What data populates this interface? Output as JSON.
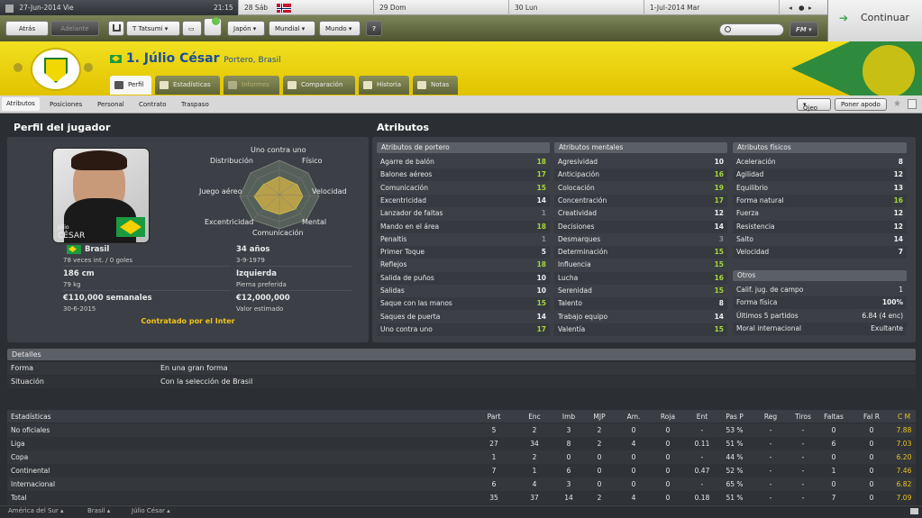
{
  "calendar": {
    "current_date": "27-Jun-2014 Vie",
    "time": "21:15",
    "days": [
      "28 Sáb",
      "29 Dom",
      "30 Lun",
      "1-Jul-2014 Mar"
    ]
  },
  "nav": {
    "back": "Atrás",
    "forward": "Adelante",
    "manager": "T Tatsumi",
    "menus": [
      "Japón",
      "Mundial",
      "Mundo"
    ],
    "help": "?",
    "search_placeholder": "",
    "fm": "FM",
    "continue": "Continuar"
  },
  "header": {
    "number_name": "1. Júlio César",
    "subtitle": "Portero, Brasil",
    "tabs": [
      "Perfil",
      "Estadísticas",
      "Informes",
      "Comparación",
      "Historia",
      "Notas"
    ],
    "accent": "#f1e020",
    "brand": "#2e8b3e"
  },
  "subnav": {
    "items": [
      "Atributos",
      "Posiciones",
      "Personal",
      "Contrato",
      "Traspaso"
    ],
    "right": [
      "Ojeo",
      "Poner apodo"
    ]
  },
  "profile": {
    "title": "Perfil del jugador",
    "card_first": "Júlio",
    "card_last": "CÉSAR",
    "radar_labels": [
      "Uno contra uno",
      "Físico",
      "Velocidad",
      "Mental",
      "Comunicación",
      "Excentricidad",
      "Juego aéreo",
      "Distribución"
    ],
    "info": [
      {
        "main": "Brasil",
        "sub": "78 veces int. / 0 goles"
      },
      {
        "main": "34 años",
        "sub": "3-9-1979"
      },
      {
        "main": "186 cm",
        "sub": "79 kg"
      },
      {
        "main": "Izquierda",
        "sub": "Pierna preferida"
      },
      {
        "main": "€110,000 semanales",
        "sub": "30-6-2015"
      },
      {
        "main": "€12,000,000",
        "sub": "Valor estimado"
      }
    ],
    "contracted": "Contratado por el Inter"
  },
  "attributes": {
    "title": "Atributos",
    "goalkeeper": {
      "header": "Atributos de portero",
      "items": [
        [
          "Agarre de balón",
          "18"
        ],
        [
          "Balones aéreos",
          "17"
        ],
        [
          "Comunicación",
          "15"
        ],
        [
          "Excentricidad",
          "14"
        ],
        [
          "Lanzador de faltas",
          "1"
        ],
        [
          "Mando en el área",
          "18"
        ],
        [
          "Penaltis",
          "1"
        ],
        [
          "Primer Toque",
          "5"
        ],
        [
          "Reflejos",
          "18"
        ],
        [
          "Salida de puños",
          "10"
        ],
        [
          "Salidas",
          "10"
        ],
        [
          "Saque con las manos",
          "15"
        ],
        [
          "Saques de puerta",
          "14"
        ],
        [
          "Uno contra uno",
          "17"
        ]
      ]
    },
    "mental": {
      "header": "Atributos mentales",
      "items": [
        [
          "Agresividad",
          "10"
        ],
        [
          "Anticipación",
          "16"
        ],
        [
          "Colocación",
          "19"
        ],
        [
          "Concentración",
          "17"
        ],
        [
          "Creatividad",
          "12"
        ],
        [
          "Decisiones",
          "14"
        ],
        [
          "Desmarques",
          "3"
        ],
        [
          "Determinación",
          "15"
        ],
        [
          "Influencia",
          "15"
        ],
        [
          "Lucha",
          "16"
        ],
        [
          "Serenidad",
          "15"
        ],
        [
          "Talento",
          "8"
        ],
        [
          "Trabajo equipo",
          "14"
        ],
        [
          "Valentía",
          "15"
        ]
      ]
    },
    "physical": {
      "header": "Atributos físicos",
      "items": [
        [
          "Aceleración",
          "8"
        ],
        [
          "Agilidad",
          "12"
        ],
        [
          "Equilibrio",
          "13"
        ],
        [
          "Forma natural",
          "16"
        ],
        [
          "Fuerza",
          "12"
        ],
        [
          "Resistencia",
          "12"
        ],
        [
          "Salto",
          "14"
        ],
        [
          "Velocidad",
          "7"
        ]
      ]
    },
    "other": {
      "header": "Otros",
      "items": [
        [
          "Calif. jug. de campo",
          "1"
        ],
        [
          "Forma física",
          "100%"
        ],
        [
          "Últimos 5 partidos",
          "6.84 (4 enc)"
        ],
        [
          "Moral internacional",
          "Exultante"
        ]
      ]
    }
  },
  "details": {
    "header": "Detalles",
    "rows": [
      [
        "Forma",
        "En una gran forma"
      ],
      [
        "Situación",
        "Con la selección de Brasil"
      ]
    ]
  },
  "stats": {
    "columns": [
      "Estadísticas",
      "Part",
      "Enc",
      "Imb",
      "MJP",
      "Am.",
      "Roja",
      "Ent",
      "Pas P",
      "Reg",
      "Tiros",
      "Faltas",
      "Fal R",
      "C M"
    ],
    "rows": [
      [
        "No oficiales",
        "5",
        "2",
        "3",
        "2",
        "0",
        "0",
        "-",
        "53 %",
        "-",
        "-",
        "0",
        "0",
        "7.88"
      ],
      [
        "Liga",
        "27",
        "34",
        "8",
        "2",
        "4",
        "0",
        "0.11",
        "51 %",
        "-",
        "-",
        "6",
        "0",
        "7.03"
      ],
      [
        "Copa",
        "1",
        "2",
        "0",
        "0",
        "0",
        "0",
        "-",
        "44 %",
        "-",
        "-",
        "0",
        "0",
        "6.20"
      ],
      [
        "Continental",
        "7",
        "1",
        "6",
        "0",
        "0",
        "0",
        "0.47",
        "52 %",
        "-",
        "-",
        "1",
        "0",
        "7.46"
      ],
      [
        "Internacional",
        "6",
        "4",
        "3",
        "0",
        "0",
        "0",
        "-",
        "65 %",
        "-",
        "-",
        "0",
        "0",
        "6.82"
      ],
      [
        "Total",
        "35",
        "37",
        "14",
        "2",
        "4",
        "0",
        "0.18",
        "51 %",
        "-",
        "-",
        "7",
        "0",
        "7.09"
      ]
    ]
  },
  "footer": {
    "crumbs": [
      "América del Sur",
      "Brasil",
      "Júlio César"
    ]
  }
}
